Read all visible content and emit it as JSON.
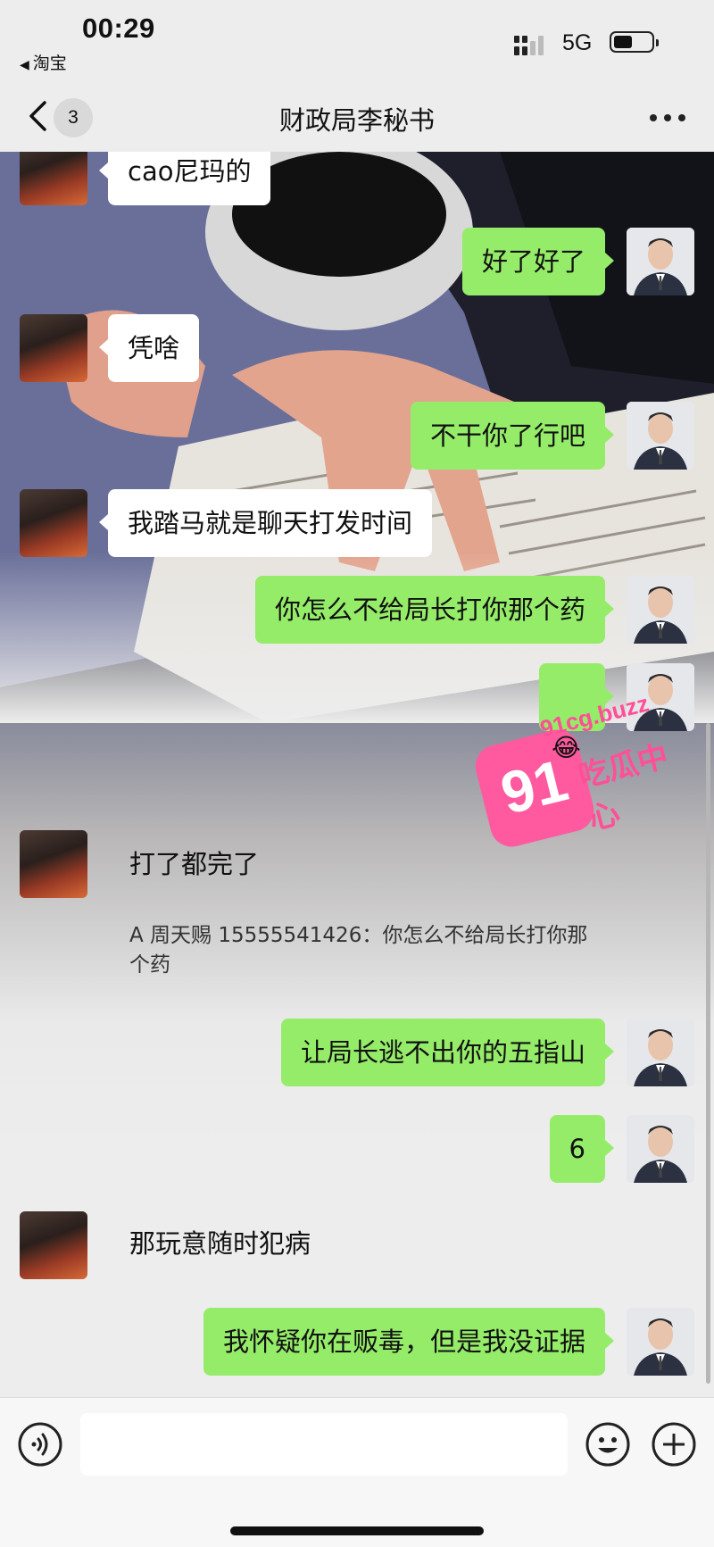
{
  "status_bar": {
    "time": "00:29",
    "back_app": "淘宝",
    "network": "5G"
  },
  "nav": {
    "unread_count": "3",
    "title": "财政局李秘书"
  },
  "messages": [
    {
      "from": "her",
      "type": "bubble",
      "text": "cao尼玛的"
    },
    {
      "from": "me",
      "type": "bubble",
      "text": "好了好了"
    },
    {
      "from": "her",
      "type": "bubble",
      "text": "凭啥"
    },
    {
      "from": "me",
      "type": "bubble",
      "text": "不干你了行吧"
    },
    {
      "from": "her",
      "type": "bubble",
      "text": "我踏马就是聊天打发时间"
    },
    {
      "from": "me",
      "type": "bubble",
      "text": "你怎么不给局长打你那个药"
    },
    {
      "from": "me",
      "type": "bubble",
      "text": ""
    },
    {
      "from": "her",
      "type": "plain",
      "text": "打了都完了",
      "quote": "A 周天赐 15555541426：你怎么不给局长打你那个药"
    },
    {
      "from": "me",
      "type": "bubble",
      "text": "让局长逃不出你的五指山"
    },
    {
      "from": "me",
      "type": "bubble",
      "text": "6"
    },
    {
      "from": "her",
      "type": "plain",
      "text": "那玩意随时犯病"
    },
    {
      "from": "me",
      "type": "bubble",
      "text": "我怀疑你在贩毒，但是我没证据"
    }
  ],
  "watermark": {
    "logo": "91",
    "domain": "91cg.buzz",
    "name": "吃瓜中心"
  },
  "input": {
    "placeholder": ""
  },
  "colors": {
    "sent_bubble": "#95ec69",
    "received_bubble": "#ffffff",
    "background": "#ededed",
    "watermark": "#ff5aa0"
  },
  "icons": {
    "voice": "voice-icon",
    "emoji": "emoji-icon",
    "plus": "plus-icon",
    "back": "chevron-left-icon",
    "more": "more-icon"
  }
}
